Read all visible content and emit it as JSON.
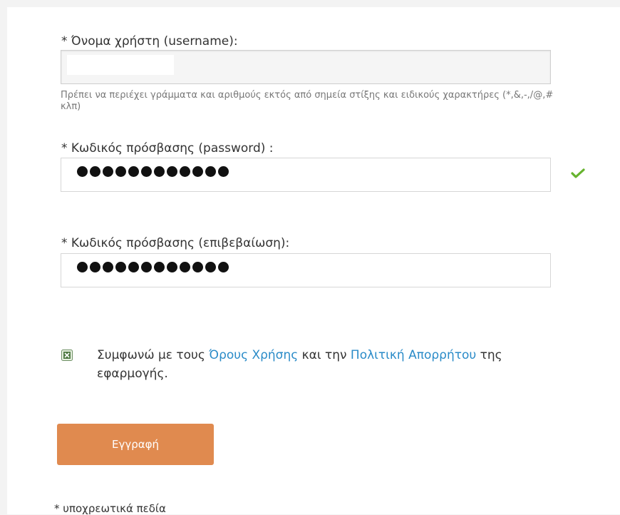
{
  "form": {
    "username": {
      "label": "* Όνομα χρήστη (username):",
      "value": "",
      "hint": "Πρέπει να περιέχει γράμματα και αριθμούς εκτός από σημεία στίξης και ειδικούς χαρακτήρες (*,&,-,/@,# κλπ)"
    },
    "password": {
      "label": "* Κωδικός πρόσβασης (password) :",
      "masked_length": 12,
      "status_icon": "check-icon",
      "status_color": "#66b32e"
    },
    "password_confirm": {
      "label": "* Κωδικός πρόσβασης (επιβεβαίωση):",
      "masked_length": 12
    },
    "terms": {
      "text_before": "Συμφωνώ με τους ",
      "link_terms": "Όρους Χρήσης",
      "text_middle": " και την ",
      "link_privacy": "Πολιτική Απορρήτου",
      "text_after": " της εφαρμογής.",
      "checked": true
    },
    "submit_label": "Εγγραφή",
    "required_note": "* υποχρεωτικά πεδία"
  },
  "colors": {
    "accent_button": "#e08a4f",
    "link": "#2a8bc8",
    "success": "#66b32e"
  }
}
